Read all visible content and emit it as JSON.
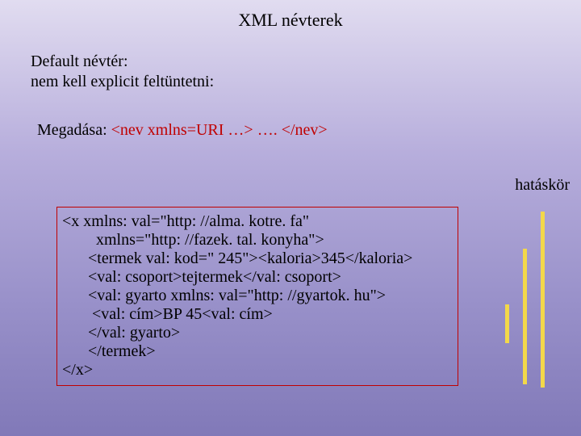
{
  "title": "XML névterek",
  "block1": {
    "line1": "Default névtér:",
    "line2": " nem kell explicit feltüntetni:"
  },
  "block2": {
    "prefix": "Megadása: ",
    "expr": "<nev  xmlns=URI …> …. </nev>"
  },
  "scope_label": "hatáskör",
  "code": {
    "l1": "<x xmlns: val=\"http: //alma. kotre. fa\"",
    "l2": "  xmlns=\"http: //fazek. tal. konyha\">",
    "l3": "<termek val: kod=\" 245\"><kaloria>345</kaloria>",
    "l4": "<val: csoport>tejtermek</val: csoport>",
    "l5": "<val: gyarto xmlns: val=\"http: //gyartok. hu\">",
    "l6": " <val: cím>BP 45<val: cím>",
    "l7": "</val: gyarto>",
    "l8": "</termek>",
    "l9": "</x>"
  }
}
